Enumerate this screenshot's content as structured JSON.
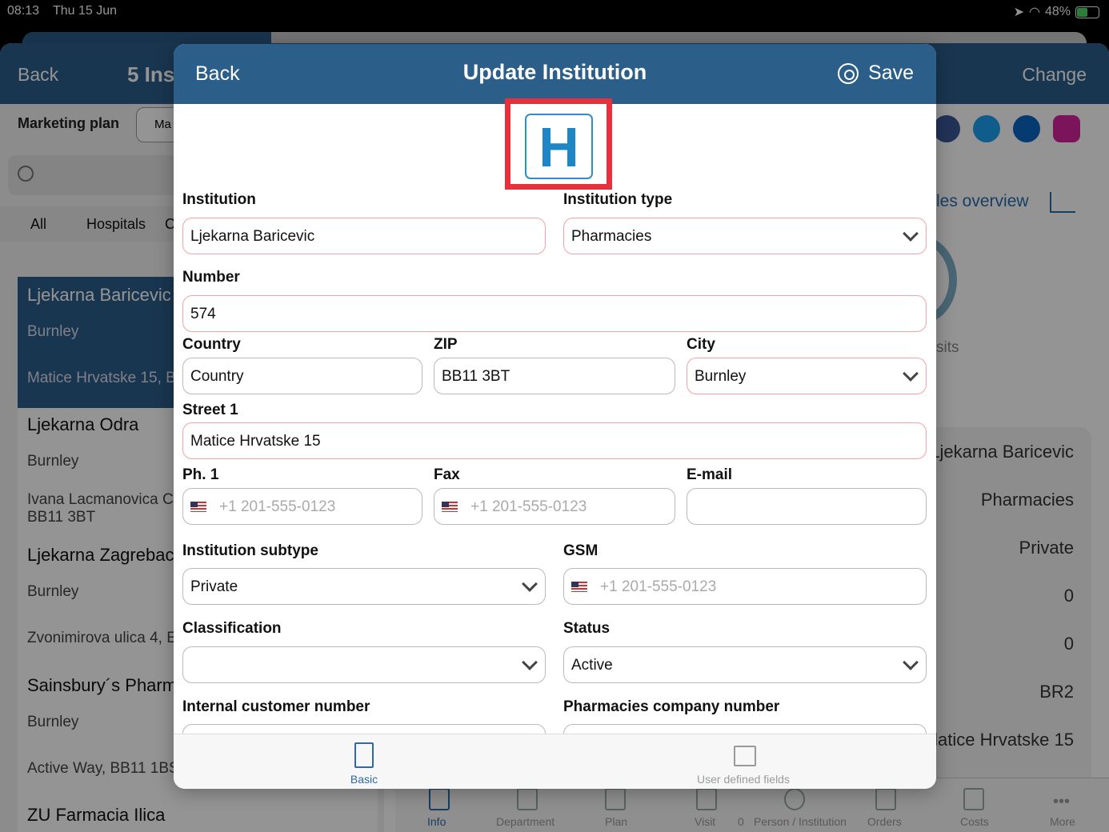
{
  "status_bar": {
    "time": "08:13",
    "date": "Thu 15 Jun",
    "battery": "48%"
  },
  "background": {
    "back_label": "Back",
    "title": "5 Ins",
    "change_label": "Change",
    "marketing_plan_label": "Marketing plan",
    "marketing_plan_value": "Ma",
    "segments": [
      "All",
      "Hospitals",
      "C"
    ],
    "list": [
      {
        "name": "Ljekarna Baricevic",
        "city": "Burnley",
        "address": "Matice Hrvatske 15, B"
      },
      {
        "name": "Ljekarna Odra",
        "city": "Burnley",
        "address": "Ivana Lacmanovica C",
        "address2": "BB11 3BT"
      },
      {
        "name": "Ljekarna Zagrebac",
        "city": "Burnley",
        "address": "Zvonimirova ulica 4, E"
      },
      {
        "name": "Sainsbury´s Pharm",
        "city": "Burnley",
        "address": "Active Way, BB11 1BS"
      },
      {
        "name": "ZU Farmacia Ilica"
      }
    ],
    "sales_overview": "les overview",
    "visits_label": "sits",
    "table_values": [
      "Ljekarna Baricevic",
      "Pharmacies",
      "Private",
      "0",
      "0",
      "BR2",
      "latice Hrvatske 15"
    ],
    "tabbar": [
      "Info",
      "Department",
      "Plan",
      "Visit",
      "0",
      "Person / Institution",
      "Orders",
      "Costs",
      "More"
    ]
  },
  "modal": {
    "back_label": "Back",
    "title": "Update Institution",
    "save_label": "Save",
    "logo_letter": "H",
    "fields": {
      "institution": {
        "label": "Institution",
        "value": "Ljekarna Baricevic"
      },
      "institution_type": {
        "label": "Institution type",
        "value": "Pharmacies"
      },
      "number": {
        "label": "Number",
        "value": "574"
      },
      "country": {
        "label": "Country",
        "value": "Country"
      },
      "zip": {
        "label": "ZIP",
        "value": "BB11 3BT"
      },
      "city": {
        "label": "City",
        "value": "Burnley"
      },
      "street1": {
        "label": "Street 1",
        "value": "Matice Hrvatske 15"
      },
      "phone1": {
        "label": "Ph. 1",
        "prefix": "+1",
        "placeholder": "201-555-0123"
      },
      "fax": {
        "label": "Fax",
        "prefix": "+1",
        "placeholder": "201-555-0123"
      },
      "email": {
        "label": "E-mail",
        "value": ""
      },
      "subtype": {
        "label": "Institution subtype",
        "value": "Private"
      },
      "gsm": {
        "label": "GSM",
        "prefix": "+1",
        "placeholder": "201-555-0123"
      },
      "classification": {
        "label": "Classification",
        "value": ""
      },
      "status": {
        "label": "Status",
        "value": "Active"
      },
      "internal_customer_number": {
        "label": "Internal customer number",
        "value": ""
      },
      "pharmacies_company_number": {
        "label": "Pharmacies company number",
        "value": ""
      }
    },
    "tabs": [
      {
        "label": "Basic",
        "active": true
      },
      {
        "label": "User defined fields",
        "active": false
      }
    ]
  },
  "colors": {
    "header": "#2c5e8a",
    "accent": "#2c6ba8",
    "highlight_frame": "#e8303c",
    "required_border": "#f0a4a8"
  }
}
